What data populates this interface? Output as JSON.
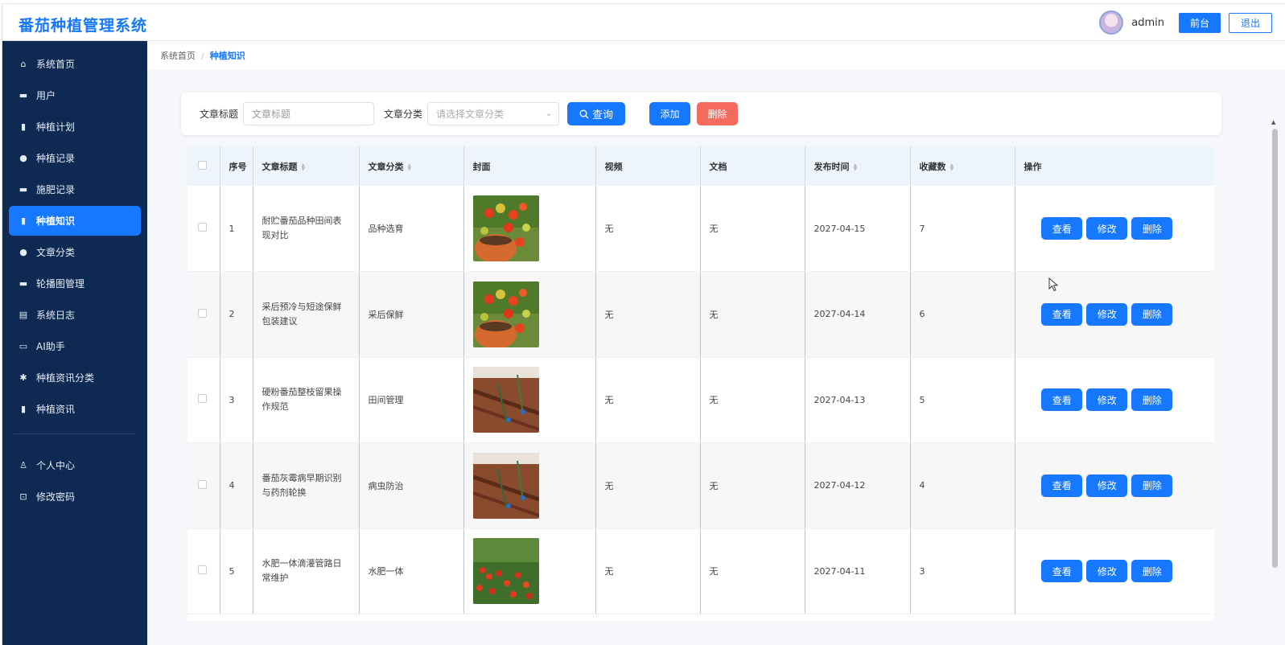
{
  "app": {
    "title": "番茄种植管理系统"
  },
  "header": {
    "username": "admin",
    "front_label": "前台",
    "logout_label": "退出"
  },
  "sidebar": {
    "items": [
      {
        "label": "系统首页",
        "icon": "home-icon",
        "glyph": "⌂"
      },
      {
        "label": "用户",
        "icon": "briefcase-icon",
        "glyph": "▬"
      },
      {
        "label": "种植计划",
        "icon": "bar-chart-icon",
        "glyph": "▮"
      },
      {
        "label": "种植记录",
        "icon": "location-pin-icon",
        "glyph": "●"
      },
      {
        "label": "施肥记录",
        "icon": "briefcase-icon",
        "glyph": "▬"
      },
      {
        "label": "种植知识",
        "icon": "bar-chart-icon",
        "glyph": "▮",
        "active": true
      },
      {
        "label": "文章分类",
        "icon": "location-pin-icon",
        "glyph": "●"
      },
      {
        "label": "轮播图管理",
        "icon": "briefcase-icon",
        "glyph": "▬"
      },
      {
        "label": "系统日志",
        "icon": "clipboard-icon",
        "glyph": "▤"
      },
      {
        "label": "AI助手",
        "icon": "monitor-icon",
        "glyph": "▭"
      },
      {
        "label": "种植资讯分类",
        "icon": "gear-icon",
        "glyph": "✱"
      },
      {
        "label": "种植资讯",
        "icon": "bar-chart-icon",
        "glyph": "▮"
      }
    ],
    "bottom_items": [
      {
        "label": "个人中心",
        "icon": "user-icon",
        "glyph": "♙"
      },
      {
        "label": "修改密码",
        "icon": "lock-icon",
        "glyph": "⊡"
      }
    ]
  },
  "breadcrumb": {
    "home": "系统首页",
    "separator": "/",
    "current": "种植知识"
  },
  "search": {
    "title_label": "文章标题",
    "title_placeholder": "文章标题",
    "category_label": "文章分类",
    "category_placeholder": "请选择文章分类",
    "query_label": "查询",
    "add_label": "添加",
    "delete_label": "删除"
  },
  "table": {
    "headers": {
      "index": "序号",
      "title": "文章标题",
      "category": "文章分类",
      "cover": "封面",
      "video": "视频",
      "document": "文档",
      "publish_time": "发布时间",
      "favorites": "收藏数",
      "actions": "操作"
    },
    "action_labels": {
      "view": "查看",
      "edit": "修改",
      "delete": "删除"
    },
    "rows": [
      {
        "index": "1",
        "title": "耐贮番茄品种田间表现对比",
        "category": "品种选育",
        "cover": "tomato-pot",
        "video": "无",
        "document": "无",
        "publish_time": "2027-04-15",
        "favorites": "7"
      },
      {
        "index": "2",
        "title": "采后预冷与短途保鲜包装建议",
        "category": "采后保鲜",
        "cover": "tomato-pot",
        "video": "无",
        "document": "无",
        "publish_time": "2027-04-14",
        "favorites": "6"
      },
      {
        "index": "3",
        "title": "硬粉番茄整枝留果操作规范",
        "category": "田间管理",
        "cover": "drip-soil",
        "video": "无",
        "document": "无",
        "publish_time": "2027-04-13",
        "favorites": "5"
      },
      {
        "index": "4",
        "title": "番茄灰霉病早期识别与药剂轮换",
        "category": "病虫防治",
        "cover": "drip-soil",
        "video": "无",
        "document": "无",
        "publish_time": "2027-04-12",
        "favorites": "4"
      },
      {
        "index": "5",
        "title": "水肥一体滴灌管路日常维护",
        "category": "水肥一体",
        "cover": "tomato-vines",
        "video": "无",
        "document": "无",
        "publish_time": "2027-04-11",
        "favorites": "3"
      }
    ]
  },
  "colors": {
    "primary": "#1677ff",
    "danger": "#f56c5f",
    "sidebar_bg": "#0e2a52",
    "active_menu": "#1677ff"
  }
}
